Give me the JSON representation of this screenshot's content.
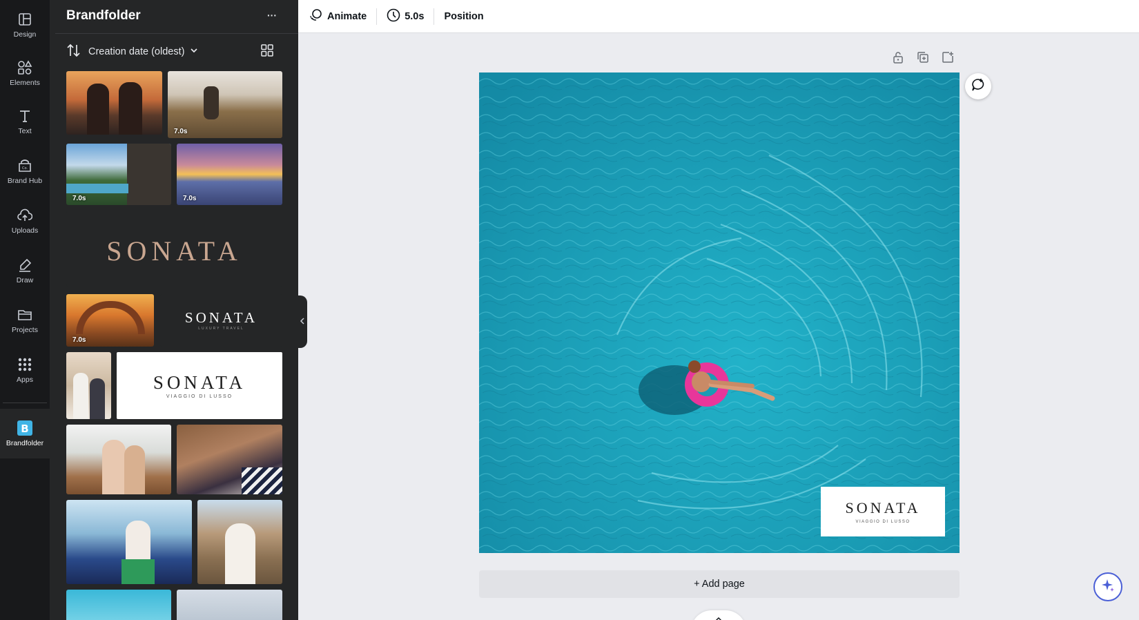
{
  "rail": {
    "items": [
      {
        "label": "Design",
        "icon": "design-icon"
      },
      {
        "label": "Elements",
        "icon": "elements-icon"
      },
      {
        "label": "Text",
        "icon": "text-icon"
      },
      {
        "label": "Brand Hub",
        "icon": "brand-hub-icon"
      },
      {
        "label": "Uploads",
        "icon": "uploads-icon"
      },
      {
        "label": "Draw",
        "icon": "draw-icon"
      },
      {
        "label": "Projects",
        "icon": "projects-icon"
      },
      {
        "label": "Apps",
        "icon": "apps-icon"
      },
      {
        "label": "Brandfolder",
        "icon": "brandfolder-icon"
      }
    ],
    "active": "Brandfolder"
  },
  "panel": {
    "title": "Brandfolder",
    "more_label": "···",
    "sort_label": "Creation date (oldest)"
  },
  "thumbs": {
    "durations": [
      "7.0s",
      "7.0s",
      "7.0s",
      "7.0s"
    ],
    "logo_main": "SONATA",
    "logo_luxury": "SONATA",
    "logo_luxury_sub": "LUXURY TRAVEL",
    "logo_white": "SONATA",
    "logo_white_sub": "VIAGGIO DI LUSSO"
  },
  "toolbar": {
    "animate_label": "Animate",
    "duration_label": "5.0s",
    "position_label": "Position"
  },
  "canvas": {
    "logo_text": "SONATA",
    "logo_sub": "VIAGGIO DI LUSSO",
    "add_page_label": "+ Add page"
  },
  "colors": {
    "rail_bg": "#18191b",
    "panel_bg": "#252627",
    "water": "#1a9bb4",
    "float_pink": "#e8369a",
    "accent": "#4a5fd6"
  }
}
